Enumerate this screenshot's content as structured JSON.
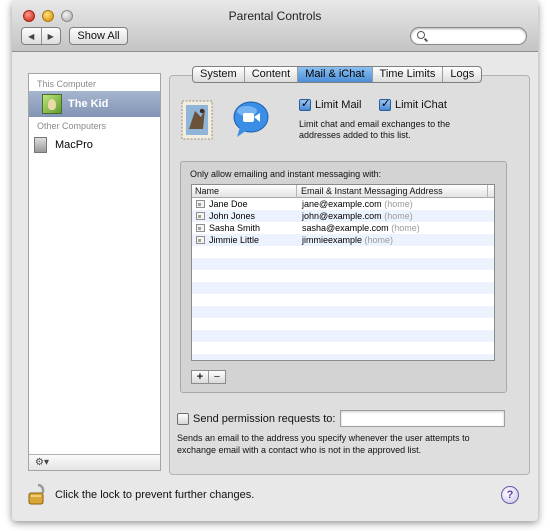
{
  "window": {
    "title": "Parental Controls"
  },
  "toolbar": {
    "back_icon": "left-arrow-icon",
    "forward_icon": "right-arrow-icon",
    "show_all_label": "Show All",
    "search_value": ""
  },
  "sidebar": {
    "this_computer_header": "This Computer",
    "selected_user": "The Kid",
    "other_computers_header": "Other Computers",
    "other_computer": "MacPro",
    "footer_icon": "gear-icon"
  },
  "tabs": [
    "System",
    "Content",
    "Mail & iChat",
    "Time Limits",
    "Logs"
  ],
  "active_tab": "Mail & iChat",
  "mail": {
    "limit_mail_label": "Limit Mail",
    "limit_mail_checked": true,
    "limit_ichat_label": "Limit iChat",
    "limit_ichat_checked": true,
    "description": "Limit chat and email exchanges to the addresses added to this list."
  },
  "allowed": {
    "title": "Only allow emailing and instant messaging with:",
    "columns": {
      "name": "Name",
      "address": "Email & Instant Messaging Address"
    },
    "contacts": [
      {
        "name": "Jane Doe",
        "address": "jane@example.com",
        "tag": "(home)"
      },
      {
        "name": "John Jones",
        "address": "john@example.com",
        "tag": "(home)"
      },
      {
        "name": "Sasha Smith",
        "address": "sasha@example.com",
        "tag": "(home)"
      },
      {
        "name": "Jimmie Little",
        "address": "jimmieexample",
        "tag": "(home)"
      }
    ],
    "add_label": "+",
    "remove_label": "−"
  },
  "permission": {
    "label": "Send permission requests to:",
    "checked": false,
    "value": "",
    "description": "Sends an email to the address you specify whenever the user attempts to exchange email with a contact who is not in the approved list."
  },
  "footer": {
    "lock_text": "Click the lock to prevent further changes.",
    "help_label": "?"
  },
  "colors": {
    "selection": "#8294b4",
    "active_tab": "#4c8fd8",
    "row_stripe": "#edf3fe"
  }
}
